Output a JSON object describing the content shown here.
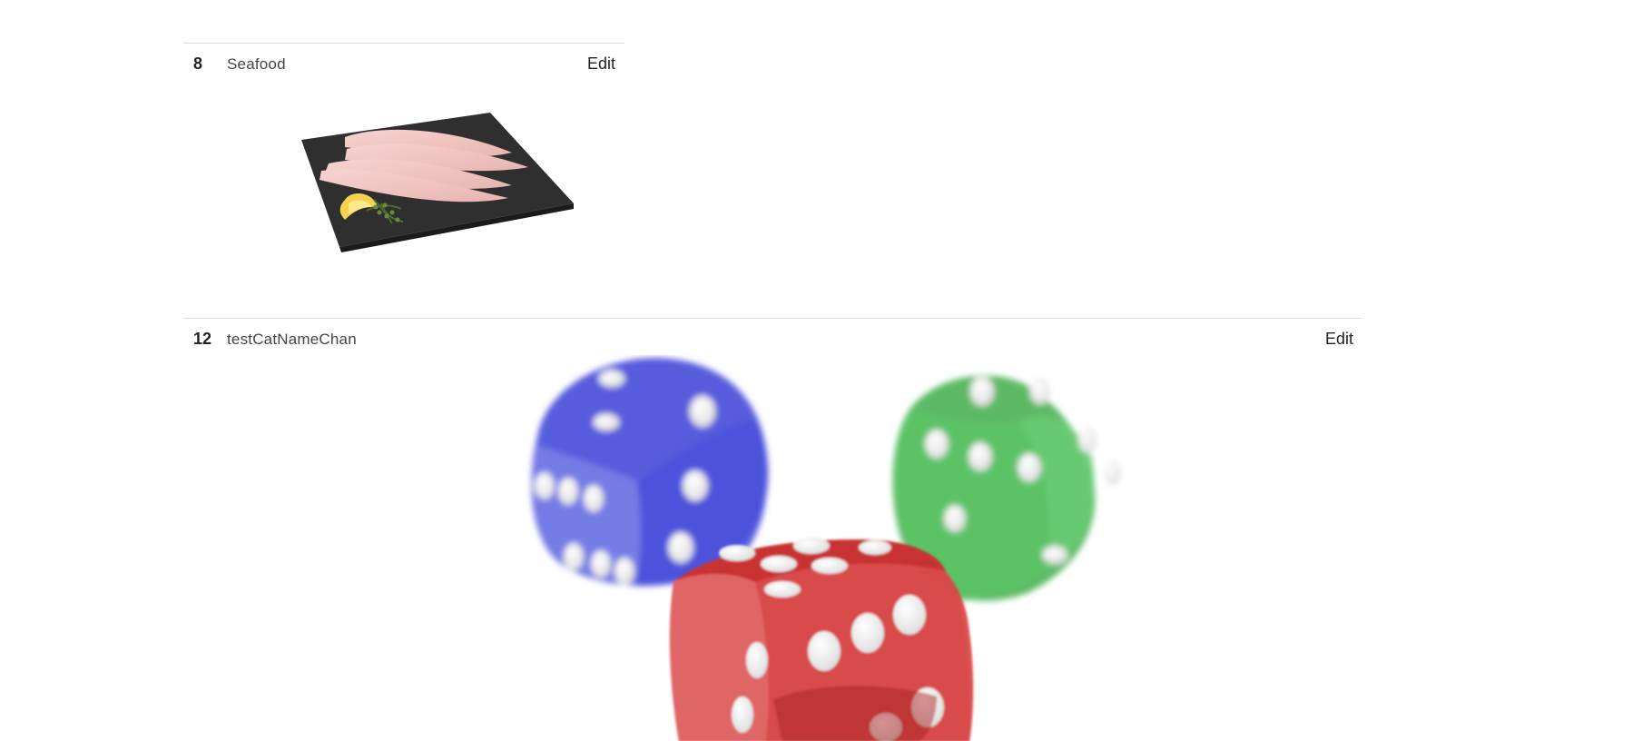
{
  "categories": [
    {
      "id": "8",
      "name": "Seafood",
      "edit_label": "Edit",
      "image": "seafood-fillets-on-slate"
    },
    {
      "id": "12",
      "name": "testCatNameChan",
      "edit_label": "Edit",
      "image": "three-dice-red-green-blue"
    }
  ],
  "colors": {
    "divider": "#dcdcdc",
    "text": "#333333",
    "die_red": "#d8403f",
    "die_green": "#3fae4a",
    "die_blue": "#3a3fd6"
  }
}
